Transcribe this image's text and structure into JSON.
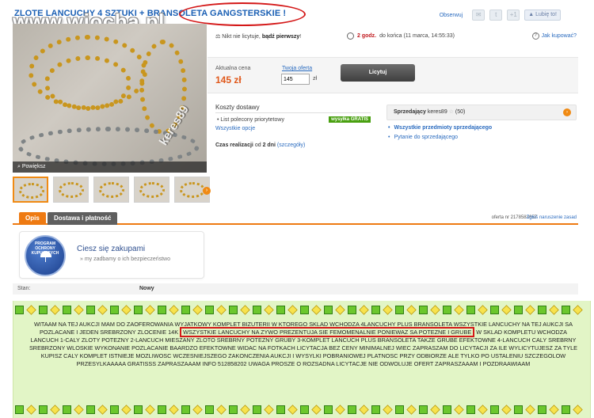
{
  "header": {
    "title_part1": "ZLOTE LANCUCHY 4 SZTUKI + BRANSOL",
    "title_part2": "ETA GANGSTERSKIE !",
    "watermark": "www.wiocha.pl",
    "observe": "Obserwuj",
    "plus_one": "+1",
    "like": "Lubię to!"
  },
  "gallery": {
    "zoom_label": "Powiększ",
    "photo_watermark": "keres89",
    "thumbnail_count": 5
  },
  "auction": {
    "bid_info_prefix": "Nikt nie licytuje,",
    "bid_info_bold": "bądź pierwszy",
    "bid_info_suffix": "!",
    "time_left": "2 godz.",
    "time_end": "do końca (11 marca, 14:55:33)",
    "how_to_buy": "Jak kupować?",
    "current_price_label": "Aktualna cena",
    "current_price": "145 zł",
    "your_offer_label": "Twoja oferta",
    "your_offer_value": "145",
    "currency": "zł",
    "bid_button": "Licytuj"
  },
  "shipping": {
    "title": "Koszty dostawy",
    "method": "List polecony priorytetowy",
    "badge": "wysyłka GRATIS",
    "all_options": "Wszystkie opcje",
    "lead_time_prefix": "Czas realizacji",
    "lead_time_mid": "od",
    "lead_time_value": "2 dni",
    "lead_time_details": "(szczegóły)"
  },
  "seller": {
    "label": "Sprzedający",
    "name": "keres89",
    "rating": "(50)",
    "link_all_items": "Wszystkie przedmioty sprzedającego",
    "link_ask": "Pytanie do sprzedającego"
  },
  "tabs": {
    "items": [
      {
        "label": "Opis"
      },
      {
        "label": "Dostawa i płatność"
      }
    ],
    "offer_number": "oferta nr 2178583657",
    "report_link": "Zgłoś naruszenie zasad"
  },
  "protection": {
    "seal_text": "PROGRAM OCHRONY KUPUJĄCYCH",
    "title": "Ciesz się zakupami",
    "subtitle": "my zadbamy o ich bezpieczeństwo"
  },
  "condition": {
    "label": "Stan:",
    "value": "Nowy"
  },
  "description": {
    "part1": "WITAAM NA TEJ AUKCJI MAM DO ZAOFEROWANIA WYJATKOWY KOMPLET BIZUTERII W KTOREGO SKLAD WCHODZA 4LANCUCHY PLUS BRANSOLETA WSZYSTKIE LANCUCHY NA TEJ AUKCJI SA POZLACANE I JEDEN SREBRZONY ZLOCENIE 14K",
    "highlight": "WSZYSTKIE LANCUCHY NA ZYWO PREZENTUJA SIE FEMOMENALNIE PONIEWAZ SA POTEZNE I GRUBE",
    "part2": "W SKLAD KOMPLETU WCHODZA LANCUCH 1-CALY ZLOTY POTEZNY 2-LANCUCH MIESZANY ZLOTO SREBRNY POTEZNY GRUBY 3-KOMPLET LANCUCH PLUS BRANSOLETA TAKZE GRUBE EFEKTOWNE 4-LANCUCH CALY SREBRNY SREBRZONY WLOSKIE WYKONANIE POZLACANIE BAARDZO EFEKTOWNE WIDAC NA FOTKACH LICYTACJA BEZ CENY MINIMALNEJ WIEC ZAPRASZAM DO LICYTACJI ZA ILE WYLICYTUJESZ ZA TYLE KUPISZ CALY KOMPLET ISTNIEJE MOZLIWOSC WCZESNIEJSZEGO ZAKONCZENIA AUKCJI I WYSYLKI POBRANIOWEJ PLATNOSC PRZY ODBIORZE ALE TYLKO PO USTALENIU SZCZEGOLOW PRZESYLKAAAAA GRATISSS ZAPRASZAAAM INFO 512858202 UWAGA PROSZE O ROZSADNA LICYTACJE NIE ODWOLUJE OFERT ZAPRASZAAAM I POZDRAAWIAAM"
  },
  "colors": {
    "accent": "#ee7a12",
    "link": "#2a6bbf",
    "price": "#e0581a",
    "highlight_ring": "#d41818",
    "description_bg": "#e2f5c6"
  }
}
